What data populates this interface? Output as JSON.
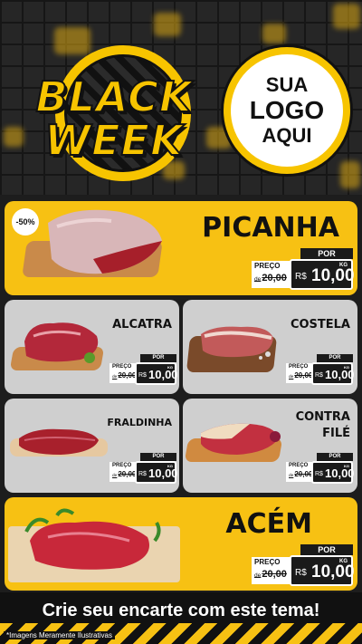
{
  "header": {
    "title_line1": "BLACK",
    "title_line2": "WEEK",
    "logo_line1": "SUA",
    "logo_line2": "LOGO",
    "logo_line3": "AQUI"
  },
  "colors": {
    "accent_yellow": "#f7c113",
    "card_gray": "#cfcfcf",
    "dark": "#1a1a1a"
  },
  "products": [
    {
      "name": "PICANHA",
      "discount": "-50%",
      "por": "POR",
      "preco": "PREÇO",
      "de": "de",
      "old_price": "20,00",
      "currency": "R$",
      "new_price": "10,00",
      "unit": "KG"
    },
    {
      "name": "ALCATRA",
      "por": "POR",
      "preco": "PREÇO",
      "de": "de",
      "old_price": "20,00",
      "currency": "R$",
      "new_price": "10,00",
      "unit": "KG"
    },
    {
      "name": "COSTELA",
      "por": "POR",
      "preco": "PREÇO",
      "de": "de",
      "old_price": "20,00",
      "currency": "R$",
      "new_price": "10,00",
      "unit": "KG"
    },
    {
      "name": "FRALDINHA",
      "por": "POR",
      "preco": "PREÇO",
      "de": "de",
      "old_price": "20,00",
      "currency": "R$",
      "new_price": "10,00",
      "unit": "KG"
    },
    {
      "name_line1": "CONTRA",
      "name_line2": "FILÉ",
      "por": "POR",
      "preco": "PREÇO",
      "de": "de",
      "old_price": "20,00",
      "currency": "R$",
      "new_price": "10,00",
      "unit": "KG"
    },
    {
      "name": "ACÉM",
      "por": "POR",
      "preco": "PREÇO",
      "de": "de",
      "old_price": "20,00",
      "currency": "R$",
      "new_price": "10,00",
      "unit": "KG"
    }
  ],
  "footer": {
    "cta": "Crie seu encarte com este tema!",
    "disclaimer": "*Imagens Meramente Ilustrativas"
  }
}
